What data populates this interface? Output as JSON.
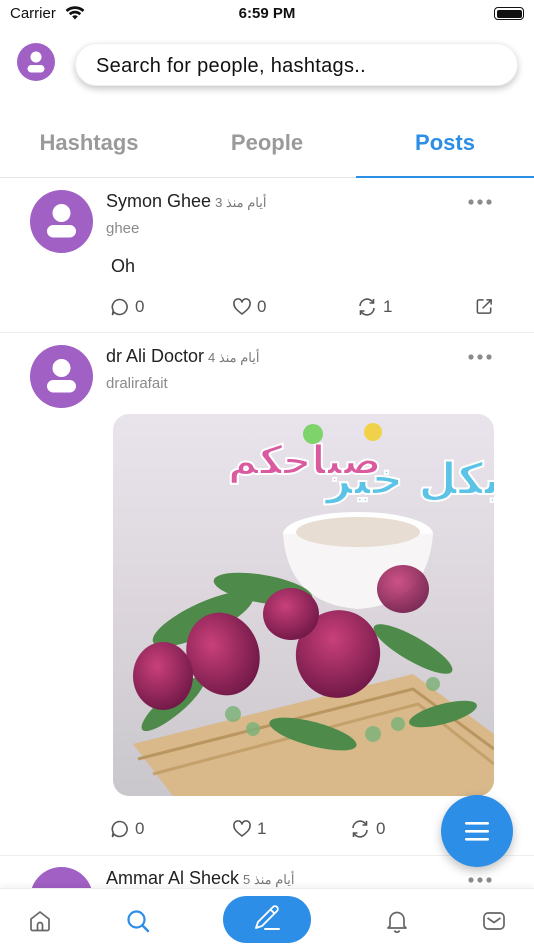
{
  "status_bar": {
    "carrier": "Carrier",
    "time": "6:59 PM"
  },
  "search": {
    "placeholder": "Search for people, hashtags.."
  },
  "tabs": [
    {
      "label": "Hashtags",
      "active": false
    },
    {
      "label": "People",
      "active": false
    },
    {
      "label": "Posts",
      "active": true
    }
  ],
  "posts": [
    {
      "name": "Symon Ghee",
      "time": "أيام منذ 3",
      "handle": "ghee",
      "text": "Oh",
      "comments": "0",
      "likes": "0",
      "reposts": "1"
    },
    {
      "name": "dr Ali Doctor",
      "time": "أيام منذ 4",
      "handle": "dralirafait",
      "image_text_1": "صباحكم",
      "image_text_2": "بكل خير",
      "comments": "0",
      "likes": "1",
      "reposts": "0"
    },
    {
      "name": "Ammar Al Sheck",
      "time": "أيام منذ 5"
    }
  ],
  "colors": {
    "accent": "#2d8ee8",
    "avatar": "#a160c4"
  }
}
